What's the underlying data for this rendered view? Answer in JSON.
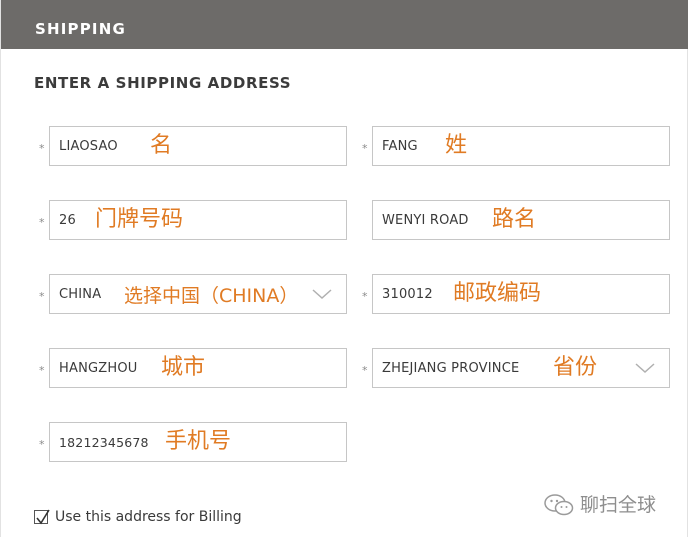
{
  "header": {
    "title": "SHIPPING"
  },
  "form": {
    "section_title": "ENTER A SHIPPING ADDRESS",
    "required_marker": "*",
    "first_name": {
      "value": "LIAOSAO",
      "annotation": "名"
    },
    "last_name": {
      "value": "FANG",
      "annotation": "姓"
    },
    "house_number": {
      "value": "26",
      "annotation": "门牌号码"
    },
    "street": {
      "value": "WENYI ROAD",
      "annotation": "路名"
    },
    "country": {
      "value": "CHINA",
      "annotation": "选择中国（CHINA）",
      "icon": "chevron-down-icon"
    },
    "postcode": {
      "value": "310012",
      "annotation": "邮政编码"
    },
    "city": {
      "value": "HANGZHOU",
      "annotation": "城市"
    },
    "province": {
      "value": "ZHEJIANG PROVINCE",
      "annotation": "省份",
      "icon": "chevron-down-icon"
    },
    "phone": {
      "value": "18212345678",
      "annotation": "手机号"
    },
    "billing": {
      "checked": true,
      "label": "Use this address for Billing"
    }
  },
  "watermark": {
    "text": "聊扫全球",
    "icon": "wechat-icon"
  },
  "colors": {
    "header_bg": "#6d6b69",
    "annotation": "#e07b24",
    "border": "#c6c6c6",
    "text": "#3a3a3a"
  }
}
